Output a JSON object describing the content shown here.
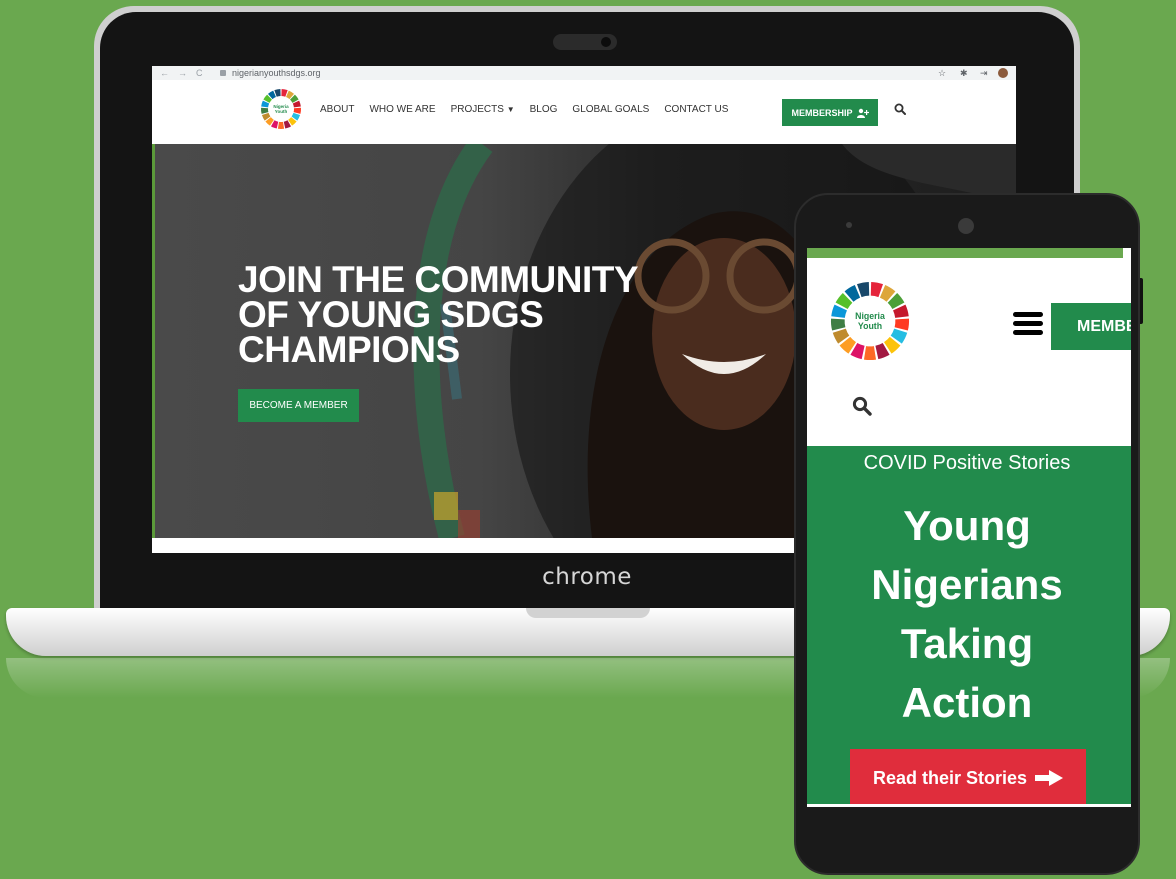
{
  "laptop": {
    "brand": "chrome",
    "browser": {
      "url": "nigerianyouthsdgs.org"
    },
    "site": {
      "logo_text": [
        "Nigeria",
        "Youth"
      ],
      "nav": [
        "ABOUT",
        "WHO WE ARE",
        "PROJECTS",
        "BLOG",
        "GLOBAL GOALS",
        "CONTACT US"
      ],
      "membership_label": "MEMBERSHIP",
      "hero_title": [
        "JOIN THE COMMUNITY",
        "OF YOUNG SDGS",
        "CHAMPIONS"
      ],
      "hero_button": "BECOME A MEMBER"
    }
  },
  "phone": {
    "logo_text": [
      "Nigeria",
      "Youth"
    ],
    "membership_label": "MEMBE",
    "kicker": "COVID Positive Stories",
    "title": [
      "Young",
      "Nigerians",
      "Taking",
      "Action"
    ],
    "cta": "Read their Stories"
  },
  "icons": {
    "search": "search-icon",
    "menu": "hamburger-menu-icon",
    "add_user": "user-plus-icon",
    "arrow": "arrow-right-icon",
    "dropdown": "caret-down-icon"
  },
  "colors": {
    "background": "#6aa84f",
    "brand_green": "#228b4c",
    "cta_red": "#e02d3c",
    "sdg_wheel": [
      "#e5243b",
      "#dda63a",
      "#4c9f38",
      "#c5192d",
      "#ff3a21",
      "#26bde2",
      "#fcc30b",
      "#a21942",
      "#fd6925",
      "#dd1367",
      "#fd9d24",
      "#bf8b2e",
      "#3f7e44",
      "#0a97d9",
      "#56c02b",
      "#00689d",
      "#19486a"
    ]
  }
}
